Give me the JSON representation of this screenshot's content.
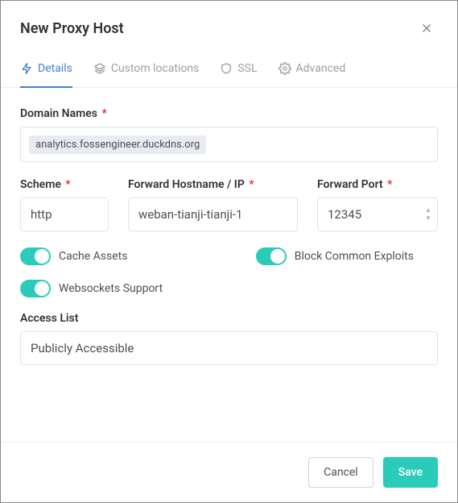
{
  "header": {
    "title": "New Proxy Host"
  },
  "tabs": {
    "details": "Details",
    "custom_locations": "Custom locations",
    "ssl": "SSL",
    "advanced": "Advanced"
  },
  "form": {
    "domain_names_label": "Domain Names",
    "domain_tag": "analytics.fossengineer.duckdns.org",
    "scheme_label": "Scheme",
    "scheme_value": "http",
    "hostname_label": "Forward Hostname / IP",
    "hostname_value": "weban-tianji-tianji-1",
    "port_label": "Forward Port",
    "port_value": "12345",
    "cache_assets_label": "Cache Assets",
    "block_exploits_label": "Block Common Exploits",
    "websockets_label": "Websockets Support",
    "access_list_label": "Access List",
    "access_list_value": "Publicly Accessible",
    "required_mark": "*"
  },
  "footer": {
    "cancel": "Cancel",
    "save": "Save"
  },
  "colors": {
    "primary_tab": "#467fcf",
    "accent_toggle": "#2bcbba",
    "required": "#e03131"
  }
}
